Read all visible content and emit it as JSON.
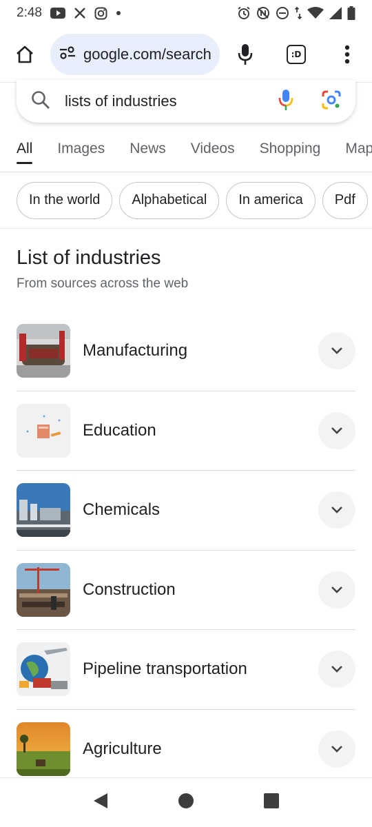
{
  "status_bar": {
    "time": "2:48",
    "left_icons": [
      "youtube-icon",
      "x-icon",
      "instagram-icon",
      "dot-icon"
    ],
    "right_icons": [
      "alarm-icon",
      "nfc-icon",
      "dnd-icon",
      "data-arrows-icon",
      "wifi-icon",
      "signal-icon",
      "battery-icon"
    ]
  },
  "browser": {
    "url": "google.com/search",
    "tab_switcher_label": ":D"
  },
  "search": {
    "query": "lists of industries"
  },
  "tabs": [
    "All",
    "Images",
    "News",
    "Videos",
    "Shopping",
    "Maps"
  ],
  "active_tab": "All",
  "chips": [
    "In the world",
    "Alphabetical",
    "In america",
    "Pdf"
  ],
  "section": {
    "title": "List of industries",
    "subtitle": "From sources across the web"
  },
  "items": [
    {
      "label": "Manufacturing",
      "thumb": "factory-image"
    },
    {
      "label": "Education",
      "thumb": "notebook-image"
    },
    {
      "label": "Chemicals",
      "thumb": "chemical-plant-image"
    },
    {
      "label": "Construction",
      "thumb": "construction-site-image"
    },
    {
      "label": "Pipeline transportation",
      "thumb": "transport-collage-image"
    },
    {
      "label": "Agriculture",
      "thumb": "farm-field-image"
    }
  ],
  "colors": {
    "url_pill": "#e8eefb",
    "text_primary": "#202124",
    "text_secondary": "#5f6368",
    "divider": "#dadce0",
    "expand_bg": "#f1f3f4"
  }
}
